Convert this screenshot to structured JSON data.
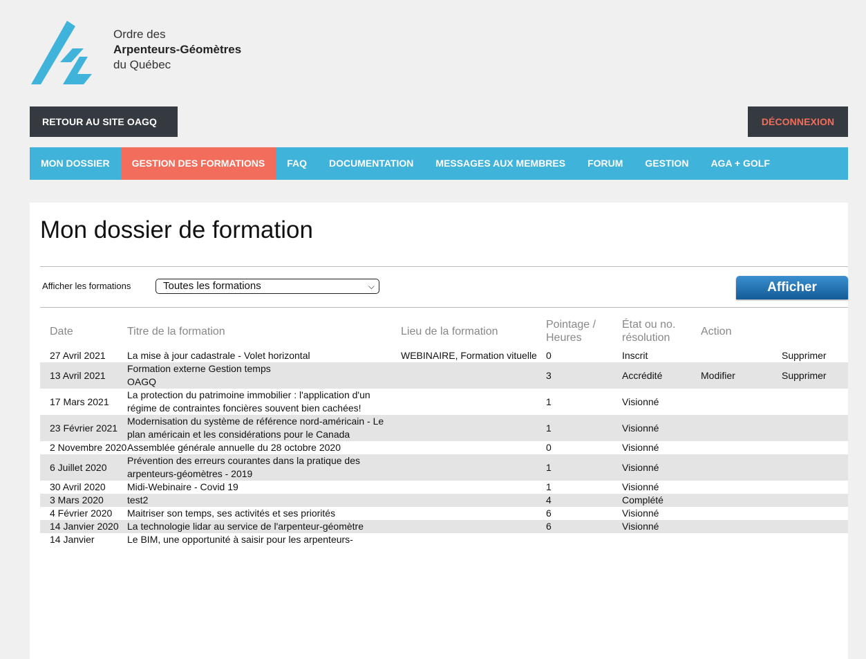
{
  "logo": {
    "line1": "Ordre des",
    "line2": "Arpenteurs-Géomètres",
    "line3": "du Québec",
    "color": "#3fb3da"
  },
  "top_buttons": {
    "back": "RETOUR AU SITE OAGQ",
    "logout": "DÉCONNEXION"
  },
  "nav": {
    "items": [
      {
        "label": "MON DOSSIER",
        "active": false
      },
      {
        "label": "GESTION DES FORMATIONS",
        "active": true
      },
      {
        "label": "FAQ",
        "active": false
      },
      {
        "label": "DOCUMENTATION",
        "active": false
      },
      {
        "label": "MESSAGES AUX MEMBRES",
        "active": false
      },
      {
        "label": "FORUM",
        "active": false
      },
      {
        "label": "GESTION",
        "active": false
      },
      {
        "label": "AGA + GOLF",
        "active": false
      }
    ]
  },
  "main": {
    "title": "Mon dossier de formation",
    "filter": {
      "label": "Afficher les formations",
      "selected": "Toutes les formations",
      "button": "Afficher"
    },
    "table": {
      "headers": {
        "date": "Date",
        "titre": "Titre de la formation",
        "lieu": "Lieu de la formation",
        "pointage": "Pointage / Heures",
        "etat": "État ou no. résolution",
        "action": "Action"
      },
      "rows": [
        {
          "date": "27 Avril 2021",
          "titre": "La mise à jour cadastrale - Volet horizontal",
          "lieu": "WEBINAIRE, Formation vituelle",
          "points": "0",
          "etat": "Inscrit",
          "modifier": "",
          "supprimer": "Supprimer"
        },
        {
          "date": "13 Avril 2021",
          "titre": "Formation externe Gestion temps\nOAGQ",
          "lieu": "",
          "points": "3",
          "etat": "Accrédité",
          "modifier": "Modifier",
          "supprimer": "Supprimer"
        },
        {
          "date": "17 Mars 2021",
          "titre": "La protection du patrimoine immobilier : l'application d'un régime de contraintes foncières souvent bien cachées!",
          "lieu": "",
          "points": "1",
          "etat": "Visionné",
          "modifier": "",
          "supprimer": ""
        },
        {
          "date": "23 Février 2021",
          "titre": "Modernisation du système de référence nord-américain - Le plan américain et les considérations pour le Canada",
          "lieu": "",
          "points": "1",
          "etat": "Visionné",
          "modifier": "",
          "supprimer": ""
        },
        {
          "date": "2 Novembre 2020",
          "titre": "Assemblée générale annuelle du 28 octobre 2020",
          "lieu": "",
          "points": "0",
          "etat": "Visionné",
          "modifier": "",
          "supprimer": ""
        },
        {
          "date": "6 Juillet 2020",
          "titre": "Prévention des erreurs courantes dans la pratique des arpenteurs-géomètres - 2019",
          "lieu": "",
          "points": "1",
          "etat": "Visionné",
          "modifier": "",
          "supprimer": ""
        },
        {
          "date": "30 Avril 2020",
          "titre": "Midi-Webinaire - Covid 19",
          "lieu": "",
          "points": "1",
          "etat": "Visionné",
          "modifier": "",
          "supprimer": ""
        },
        {
          "date": "3 Mars 2020",
          "titre": "test2",
          "lieu": "",
          "points": "4",
          "etat": "Complété",
          "modifier": "",
          "supprimer": ""
        },
        {
          "date": "4 Février 2020",
          "titre": "Maitriser son temps, ses activités et ses priorités",
          "lieu": "",
          "points": "6",
          "etat": "Visionné",
          "modifier": "",
          "supprimer": ""
        },
        {
          "date": "14 Janvier 2020",
          "titre": "La technologie lidar au service de l'arpenteur-géomètre",
          "lieu": "",
          "points": "6",
          "etat": "Visionné",
          "modifier": "",
          "supprimer": ""
        },
        {
          "date": "14 Janvier",
          "titre": "Le BIM, une opportunité à saisir pour les arpenteurs-",
          "lieu": "",
          "points": "",
          "etat": "",
          "modifier": "",
          "supprimer": ""
        }
      ]
    }
  }
}
